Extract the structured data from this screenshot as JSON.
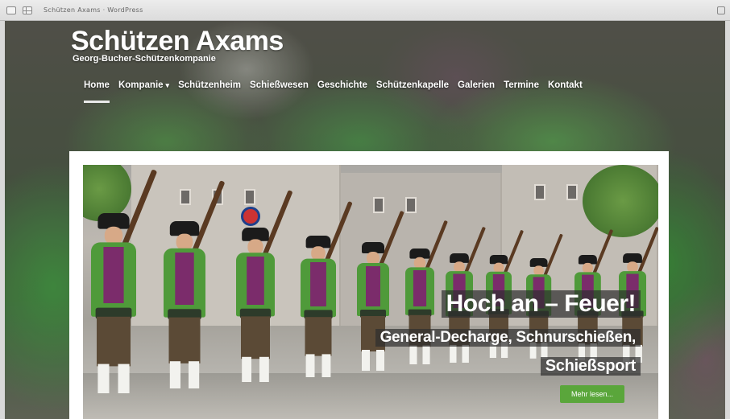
{
  "window": {
    "title": "Schützen Axams · WordPress"
  },
  "site": {
    "title": "Schützen Axams",
    "tagline": "Georg-Bucher-Schützenkompanie"
  },
  "nav": {
    "items": [
      {
        "label": "Home",
        "active": true
      },
      {
        "label": "Kompanie",
        "has_dropdown": true
      },
      {
        "label": "Schützenheim"
      },
      {
        "label": "Schießwesen"
      },
      {
        "label": "Geschichte"
      },
      {
        "label": "Schützenkapelle"
      },
      {
        "label": "Galerien"
      },
      {
        "label": "Termine"
      },
      {
        "label": "Kontakt"
      }
    ]
  },
  "hero": {
    "headline": "Hoch an – Feuer!",
    "subline_1": "General-Decharge, Schnurschießen,",
    "subline_2": "Schießsport",
    "button_label": "Mehr lesen..."
  },
  "colors": {
    "accent_green": "#5aa63b",
    "jacket_green": "#4f9a3a",
    "vest_purple": "#7b2c6b"
  }
}
